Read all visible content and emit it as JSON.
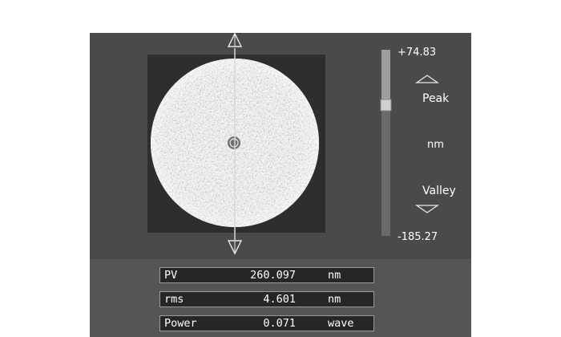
{
  "colorbar": {
    "max_label": "+74.83",
    "min_label": "-185.27",
    "peak_label": "Peak",
    "unit_label": "nm",
    "valley_label": "Valley",
    "slider_level": 0.79
  },
  "results": [
    {
      "label": "PV",
      "value": "260.097",
      "unit": "nm"
    },
    {
      "label": "rms",
      "value": "4.601",
      "unit": "nm"
    },
    {
      "label": "Power",
      "value": "0.071",
      "unit": "wave"
    }
  ],
  "colors": {
    "panel": "#4a4a4a",
    "lower_panel": "#555555",
    "map_background": "#2e2e2e",
    "field_background": "#262626"
  },
  "icons": {
    "cursor_top": "up-triangle-icon",
    "cursor_bottom": "down-triangle-icon",
    "peak": "peak-up-arrow-icon",
    "valley": "valley-down-arrow-icon"
  }
}
